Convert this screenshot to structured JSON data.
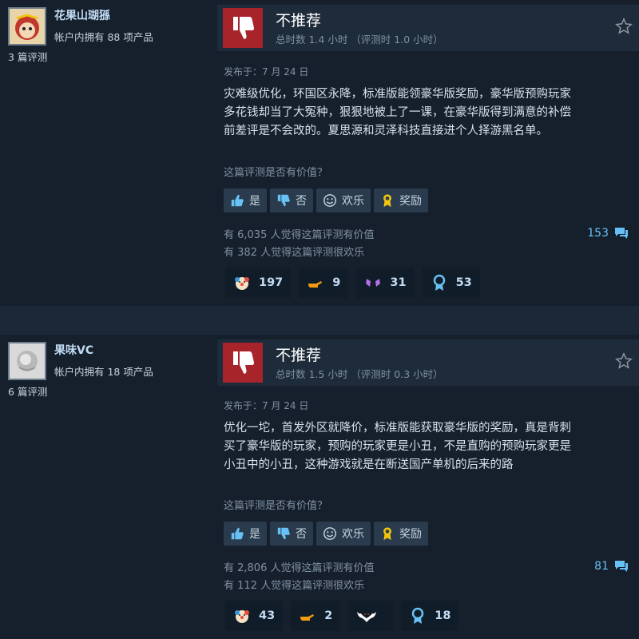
{
  "reviews": [
    {
      "username": "花果山瑚猻",
      "owned": "帐户内拥有 88 项产品",
      "review_count": "3 篇评测",
      "verdict": "不推荐",
      "hours": "总时数 1.4 小时 （评测时 1.0 小时）",
      "posted": "发布于：7 月 24 日",
      "body_lines": [
        "灾难级优化，环国区永降，标准版能领豪华版奖励，豪华版预购玩家",
        "多花钱却当了大冤种，狠狠地被上了一课，在豪华版得到满意的补偿",
        "前差评是不会改的。夏思源和灵泽科技直接进个人择游黑名单。"
      ],
      "helpful_question": "这篇评测是否有价值？",
      "buttons": {
        "yes": "是",
        "no": "否",
        "funny": "欢乐",
        "award": "奖励"
      },
      "helpful_stat": "有 6,035 人觉得这篇评测有价值",
      "funny_stat": "有 382 人觉得这篇评测很欢乐",
      "comments": "153",
      "awards": [
        {
          "icon": "clown-face-icon",
          "count": "197"
        },
        {
          "icon": "pointing-hand-icon",
          "count": "9"
        },
        {
          "icon": "hands-icon",
          "count": "31"
        },
        {
          "icon": "medal-icon",
          "count": "53"
        }
      ]
    },
    {
      "username": "果味VC",
      "owned": "帐户内拥有 18 项产品",
      "review_count": "6 篇评测",
      "verdict": "不推荐",
      "hours": "总时数 1.5 小时 （评测时 0.3 小时）",
      "posted": "发布于：7 月 24 日",
      "body_lines": [
        "优化一坨，首发外区就降价，标准版能获取豪华版的奖励，真是背刺",
        "买了豪华版的玩家，预购的玩家更是小丑，不是直购的预购玩家更是",
        "小丑中的小丑，这种游戏就是在断送国产单机的后来的路"
      ],
      "helpful_question": "这篇评测是否有价值？",
      "buttons": {
        "yes": "是",
        "no": "否",
        "funny": "欢乐",
        "award": "奖励"
      },
      "helpful_stat": "有 2,806 人觉得这篇评测有价值",
      "funny_stat": "有 112 人觉得这篇评测很欢乐",
      "comments": "81",
      "awards": [
        {
          "icon": "clown-face-icon",
          "count": "43"
        },
        {
          "icon": "pointing-hand-icon",
          "count": "2"
        },
        {
          "icon": "bat-icon",
          "count": ""
        },
        {
          "icon": "medal-icon",
          "count": "18"
        }
      ]
    }
  ],
  "colors": {
    "thumbs_down_bg": "#a8242b",
    "link_blue": "#66c0f4",
    "page_bg": "#1b2838"
  }
}
